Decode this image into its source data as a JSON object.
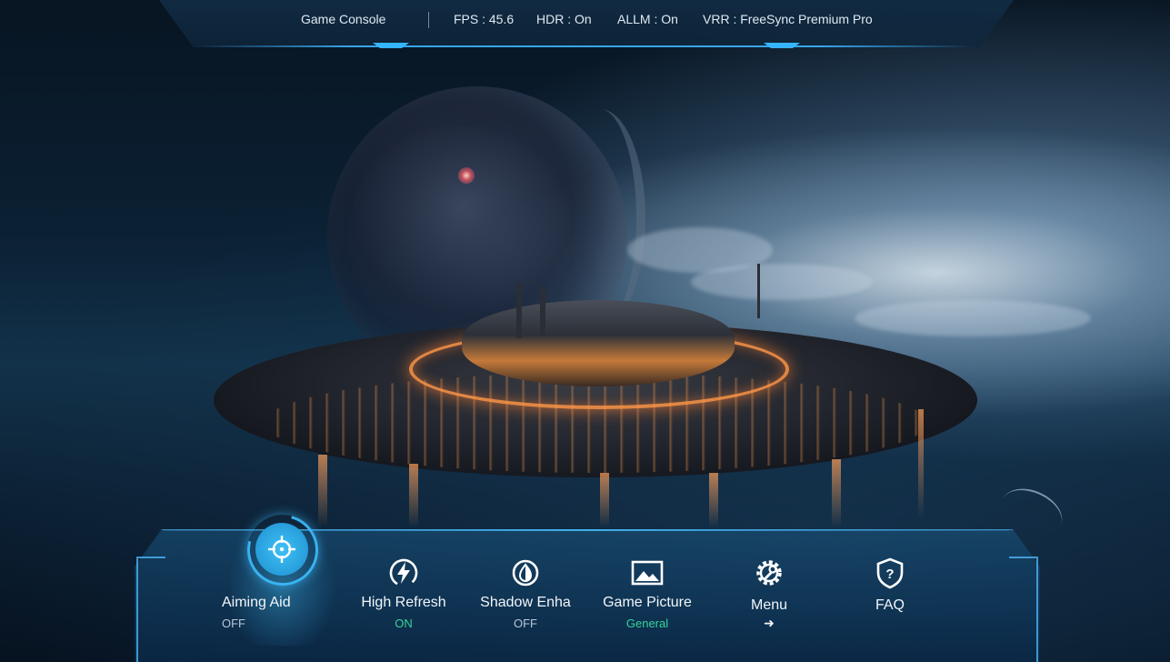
{
  "top_bar": {
    "title": "Game Console",
    "fps": "FPS : 45.6",
    "hdr": "HDR : On",
    "allm": "ALLM : On",
    "vrr": "VRR : FreeSync Premium Pro"
  },
  "dock": {
    "items": [
      {
        "label": "Aiming Aid",
        "status": "OFF",
        "icon": "crosshair-icon",
        "active": true
      },
      {
        "label": "High Refresh",
        "status": "ON",
        "icon": "lightning-icon"
      },
      {
        "label": "Shadow Enha",
        "status": "OFF",
        "icon": "contrast-drop-icon"
      },
      {
        "label": "Game Picture",
        "status": "General",
        "icon": "picture-icon"
      },
      {
        "label": "Menu",
        "status": "➜",
        "icon": "gear-wrench-icon"
      },
      {
        "label": "FAQ",
        "status": "",
        "icon": "question-shield-icon"
      }
    ]
  },
  "colors": {
    "accent": "#35b5ff",
    "status_on": "#37d39a",
    "status_off": "#b9c8d6",
    "text": "#f2f6fa"
  }
}
